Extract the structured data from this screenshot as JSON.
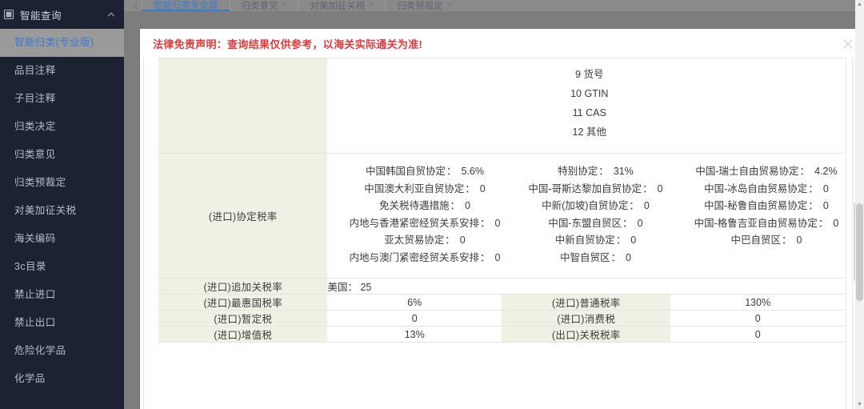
{
  "sidebar": {
    "header": {
      "label": "智能查询",
      "icon": "book-icon",
      "chevron": "chevron-up-icon"
    },
    "items": [
      {
        "label": "智能归类(专业版)",
        "active": true
      },
      {
        "label": "品目注释",
        "active": false
      },
      {
        "label": "子目注释",
        "active": false
      },
      {
        "label": "归类决定",
        "active": false
      },
      {
        "label": "归类意见",
        "active": false
      },
      {
        "label": "归类预裁定",
        "active": false
      },
      {
        "label": "对美加征关税",
        "active": false
      },
      {
        "label": "海关编码",
        "active": false
      },
      {
        "label": "3c目录",
        "active": false
      },
      {
        "label": "禁止进口",
        "active": false
      },
      {
        "label": "禁止出口",
        "active": false
      },
      {
        "label": "危险化学品",
        "active": false
      },
      {
        "label": "化学品",
        "active": false
      }
    ]
  },
  "tabbar": {
    "back_arrow": "chevron-left-icon",
    "tabs": [
      {
        "label": "智能归类专业版",
        "active": true,
        "close": "×"
      },
      {
        "label": "归类意见",
        "active": false,
        "close": "×"
      },
      {
        "label": "对美加征关税",
        "active": false,
        "close": "×"
      },
      {
        "label": "归类预裁定",
        "active": false,
        "close": "×"
      }
    ]
  },
  "modal": {
    "disclaimer": "法律免责声明：查询结果仅供参考，以海关实际通关为准!",
    "disclaimer_color": "#e03a3a",
    "close_icon": "close-icon"
  },
  "table": {
    "declaration_items": [
      "9 货号",
      "10 GTIN",
      "11 CAS",
      "12 其他"
    ],
    "agreement_row": {
      "label": "(进口)协定税率",
      "columns": [
        [
          {
            "name": "中国韩国自贸协定",
            "value": "5.6%"
          },
          {
            "name": "中国澳大利亚自贸协定",
            "value": "0"
          },
          {
            "name": "免关税待遇措施",
            "value": "0"
          },
          {
            "name": "内地与香港紧密经贸关系安排",
            "value": "0"
          },
          {
            "name": "亚太贸易协定",
            "value": "0"
          },
          {
            "name": "内地与澳门紧密经贸关系安排",
            "value": "0"
          }
        ],
        [
          {
            "name": "特别协定",
            "value": "31%"
          },
          {
            "name": "中国-哥斯达黎加自贸协定",
            "value": "0"
          },
          {
            "name": "中新(加坡)自贸协定",
            "value": "0"
          },
          {
            "name": "中国-东盟自贸区",
            "value": "0"
          },
          {
            "name": "中新自贸协定",
            "value": "0"
          },
          {
            "name": "中智自贸区",
            "value": "0"
          }
        ],
        [
          {
            "name": "中国-瑞士自由贸易协定",
            "value": "4.2%"
          },
          {
            "name": "中国-冰岛自由贸易协定",
            "value": "0"
          },
          {
            "name": "中国-秘鲁自由贸易协定",
            "value": "0"
          },
          {
            "name": "中国-格鲁吉亚自由贸易协定",
            "value": "0"
          },
          {
            "name": "中巴自贸区",
            "value": "0"
          }
        ]
      ]
    },
    "surcharge_row": {
      "label": "(进口)追加关税率",
      "value": "美国：  25"
    },
    "rate_rows": [
      {
        "label_left": "(进口)最惠国税率",
        "value_left": "6%",
        "label_right": "(进口)普通税率",
        "value_right": "130%"
      },
      {
        "label_left": "(进口)暂定税",
        "value_left": "0",
        "label_right": "(进口)消费税",
        "value_right": "0"
      },
      {
        "label_left": "(进口)增值税",
        "value_left": "13%",
        "label_right": "(出口)关税税率",
        "value_right": "0"
      }
    ]
  },
  "scrollbars": {
    "outer_up": "▲",
    "outer_down": "▼",
    "inner_up": "▲"
  },
  "colors": {
    "sidebar_bg": "#1d2233",
    "sidebar_active_bg": "#9a9a9a",
    "sidebar_active_text": "#3a7bd0",
    "label_cell_bg": "#f1f0e5",
    "accent": "#3a7bd0",
    "warning": "#e03a3a",
    "backdrop": "#7d7d7d"
  }
}
